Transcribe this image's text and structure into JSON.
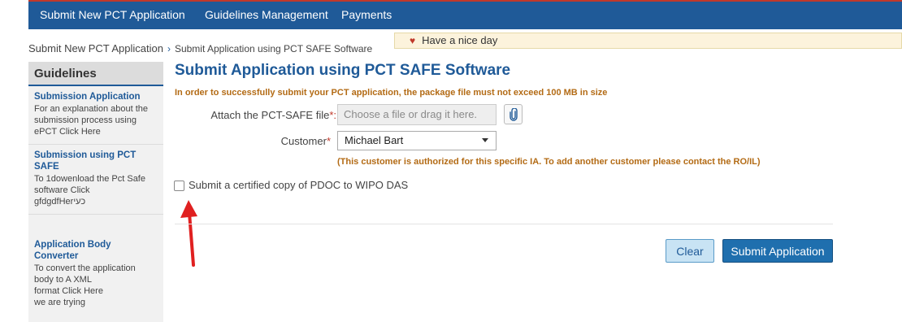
{
  "nav": {
    "items": [
      {
        "label": "Submit New PCT Application"
      },
      {
        "label": "Guidelines Management"
      },
      {
        "label": "Payments"
      }
    ]
  },
  "breadcrumb": {
    "parent": "Submit New PCT Application",
    "current": "Submit Application using PCT SAFE Software"
  },
  "message_bar": {
    "text": "Have a nice day",
    "icon": "heart-icon"
  },
  "sidebar": {
    "title": "Guidelines",
    "items": [
      {
        "title": "Submission Application",
        "lines": [
          "For an explanation about the",
          "submission process using",
          "ePCT Click Here"
        ]
      },
      {
        "title_lines": [
          "Submission using PCT",
          "SAFE"
        ],
        "lines": [
          "To 1dowenload the Pct Safe",
          "software Click",
          "gfdgdfHerכעי"
        ]
      },
      {
        "title": "Application Body Converter",
        "lines": [
          "To convert the application",
          "body to A XML",
          "format Click Here",
          "we are trying"
        ]
      }
    ]
  },
  "main": {
    "title": "Submit Application using PCT SAFE Software",
    "warning": "In order to successfully submit your PCT application, the package file must not exceed 100 MB in size",
    "file_field": {
      "label": "Attach the PCT-SAFE file",
      "required_mark": "*:",
      "placeholder": "Choose a file or drag it here."
    },
    "customer_field": {
      "label": "Customer",
      "required_mark": "*",
      "value": "Michael Bart",
      "note": "(This customer is authorized for this specific IA. To add another customer please contact the RO/IL)"
    },
    "certified_copy": {
      "label": "Submit a certified copy of PDOC to WIPO DAS",
      "checked": false
    },
    "buttons": {
      "clear": "Clear",
      "submit": "Submit Application"
    }
  },
  "colors": {
    "nav_bg": "#1f5a98",
    "accent": "#1f5a98",
    "warning_text": "#b36b15",
    "required": "#c0392b",
    "annotation_arrow": "#e02020"
  }
}
